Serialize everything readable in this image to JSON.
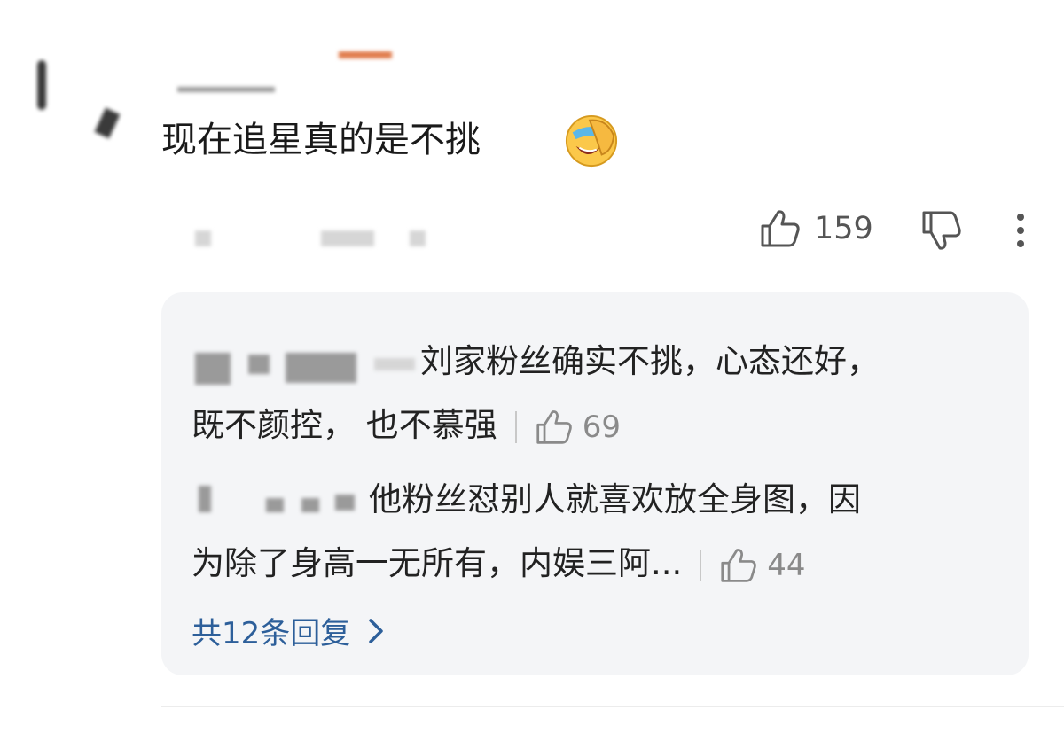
{
  "comment": {
    "text": "现在追星真的是不挑",
    "emoji": "facepalm-laugh-emoji",
    "likes": "159"
  },
  "replies": {
    "items": [
      {
        "line1": "刘家粉丝确实不挑，心态还好，",
        "line2": "既不颜控， 也不慕强",
        "likes": "69"
      },
      {
        "line1": "他粉丝怼别人就喜欢放全身图，因",
        "line2": "为除了身高一无所有，内娱三阿...",
        "likes": "44"
      }
    ],
    "more_label": "共12条回复"
  },
  "colors": {
    "link": "#2d5f9a",
    "reply_bg": "#f4f5f7"
  }
}
